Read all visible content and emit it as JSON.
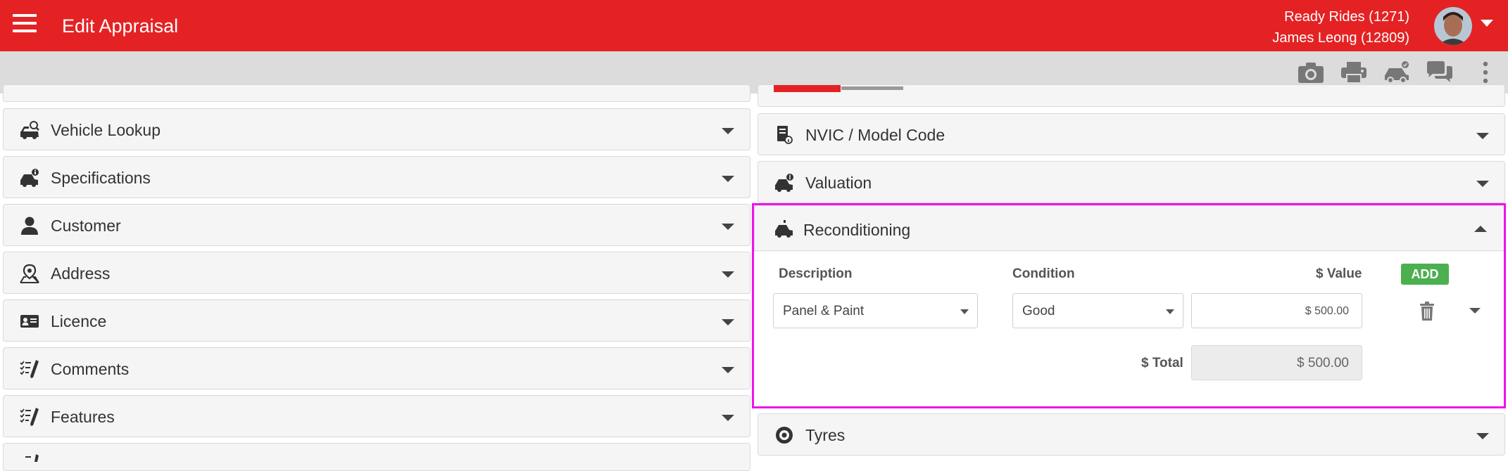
{
  "header": {
    "title": "Edit Appraisal",
    "dealer_line1": "Ready Rides (1271)",
    "dealer_line2": "James Leong (12809)"
  },
  "toolbar": {
    "icons": [
      "camera-icon",
      "print-icon",
      "car-check-icon",
      "chat-icon",
      "more-vertical-icon"
    ]
  },
  "left_panels": [
    {
      "label": "Vehicle Lookup",
      "icon": "car-search-icon"
    },
    {
      "label": "Specifications",
      "icon": "car-info-icon"
    },
    {
      "label": "Customer",
      "icon": "person-icon"
    },
    {
      "label": "Address",
      "icon": "map-pin-icon"
    },
    {
      "label": "Licence",
      "icon": "id-card-icon"
    },
    {
      "label": "Comments",
      "icon": "checklist-pen-icon"
    },
    {
      "label": "Features",
      "icon": "checklist-pen-icon"
    }
  ],
  "right_panels": {
    "nvic": "NVIC / Model Code",
    "valuation": "Valuation",
    "reconditioning": "Reconditioning",
    "tyres": "Tyres"
  },
  "reconditioning": {
    "col_description": "Description",
    "col_condition": "Condition",
    "col_value": "$ Value",
    "add_label": "ADD",
    "row": {
      "description": "Panel & Paint",
      "condition": "Good",
      "value": "$ 500.00"
    },
    "total_label": "$ Total",
    "total_value": "$ 500.00"
  },
  "colors": {
    "brand_red": "#e42224",
    "add_green": "#4caf50",
    "highlight": "#ee12ee"
  }
}
